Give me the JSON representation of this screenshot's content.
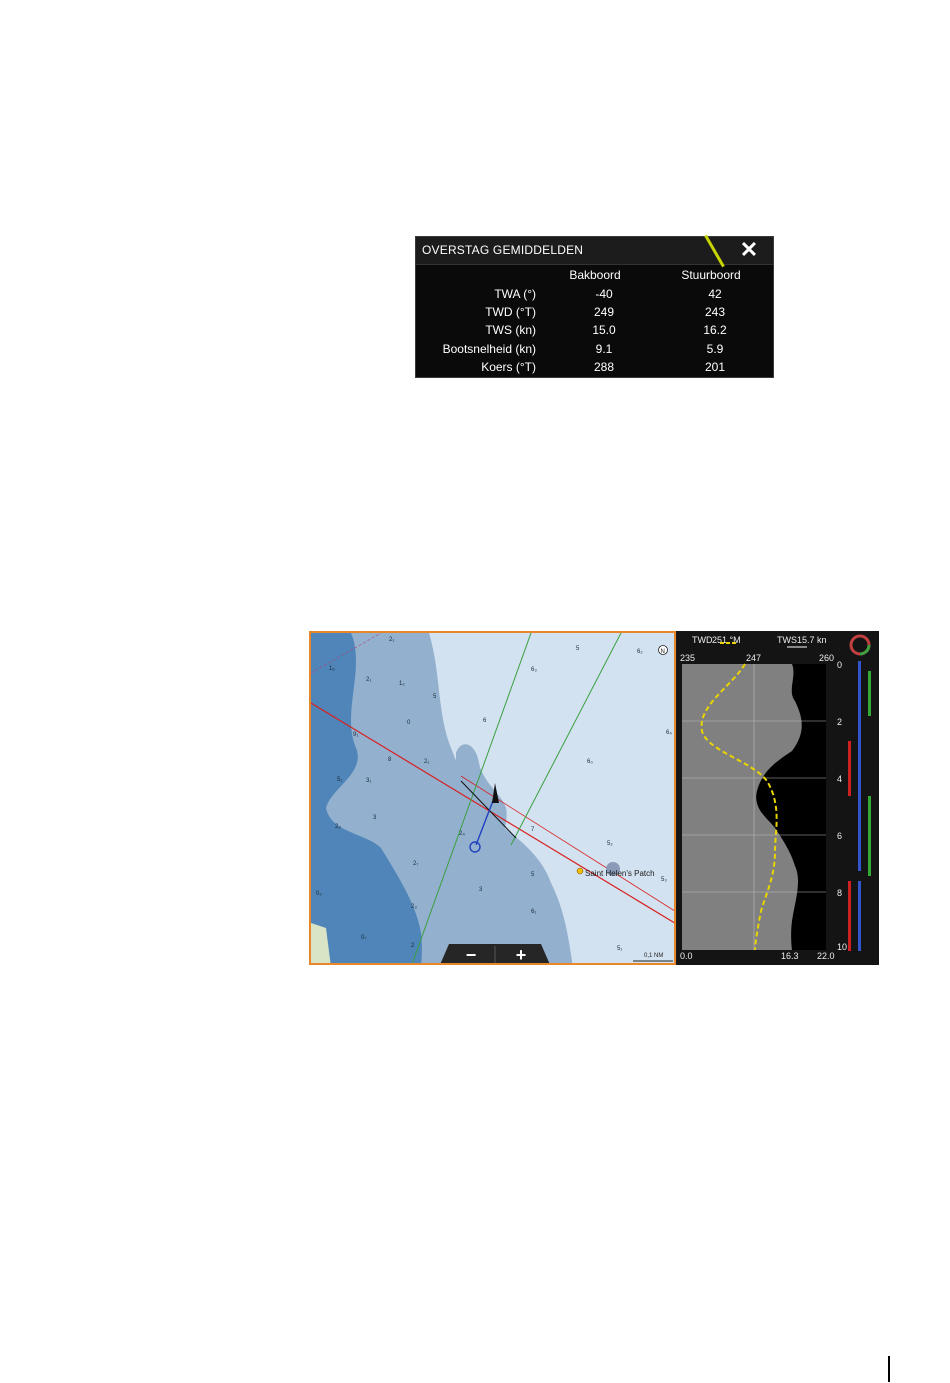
{
  "dialog": {
    "title": "OVERSTAG GEMIDDELDEN",
    "close_icon": "close-icon",
    "columns": [
      "Bakboord",
      "Stuurboord"
    ],
    "rows": [
      {
        "label": "TWA (°)",
        "port": "-40",
        "starboard": "42"
      },
      {
        "label": "TWD (°T)",
        "port": "249",
        "starboard": "243"
      },
      {
        "label": "TWS (kn)",
        "port": "15.0",
        "starboard": "16.2"
      },
      {
        "label": "Bootsnelheid (kn)",
        "port": "9.1",
        "starboard": "5.9"
      },
      {
        "label": "Koers (°T)",
        "port": "288",
        "starboard": "201"
      }
    ]
  },
  "chart": {
    "feature_label": "Saint Helen's Patch",
    "scale_label": "0,1 NM",
    "zoom_out": "−",
    "zoom_in": "+",
    "north_indicator": "N",
    "soundings": [
      "2₁",
      "1₆",
      "2₁",
      "1₂",
      "5",
      "0",
      "9₁",
      "8",
      "2₁",
      "5₁",
      "3₁",
      "2₃",
      "3",
      "2₄",
      "2₇",
      "3",
      "2₃",
      "0₂",
      "0₇",
      "6",
      "2",
      "6₃",
      "6₄",
      "6₂",
      "5",
      "7",
      "5₂",
      "5",
      "5₁",
      "6₁",
      "5₃",
      "6₀"
    ]
  },
  "sailing": {
    "twd_label": "TWD",
    "twd_value": "251 °M",
    "tws_label": "TWS",
    "tws_value": "15.7 kn",
    "twd_scale": [
      "235",
      "247",
      "260"
    ],
    "tws_scale": [
      "0.0",
      "16.3",
      "22.0"
    ],
    "depth_scale": [
      "0",
      "2",
      "4",
      "6",
      "8",
      "10"
    ],
    "colors": {
      "twd_line": "#e8d400",
      "port": "#cc2222",
      "starboard": "#33aa33",
      "blue": "#3355cc"
    }
  }
}
